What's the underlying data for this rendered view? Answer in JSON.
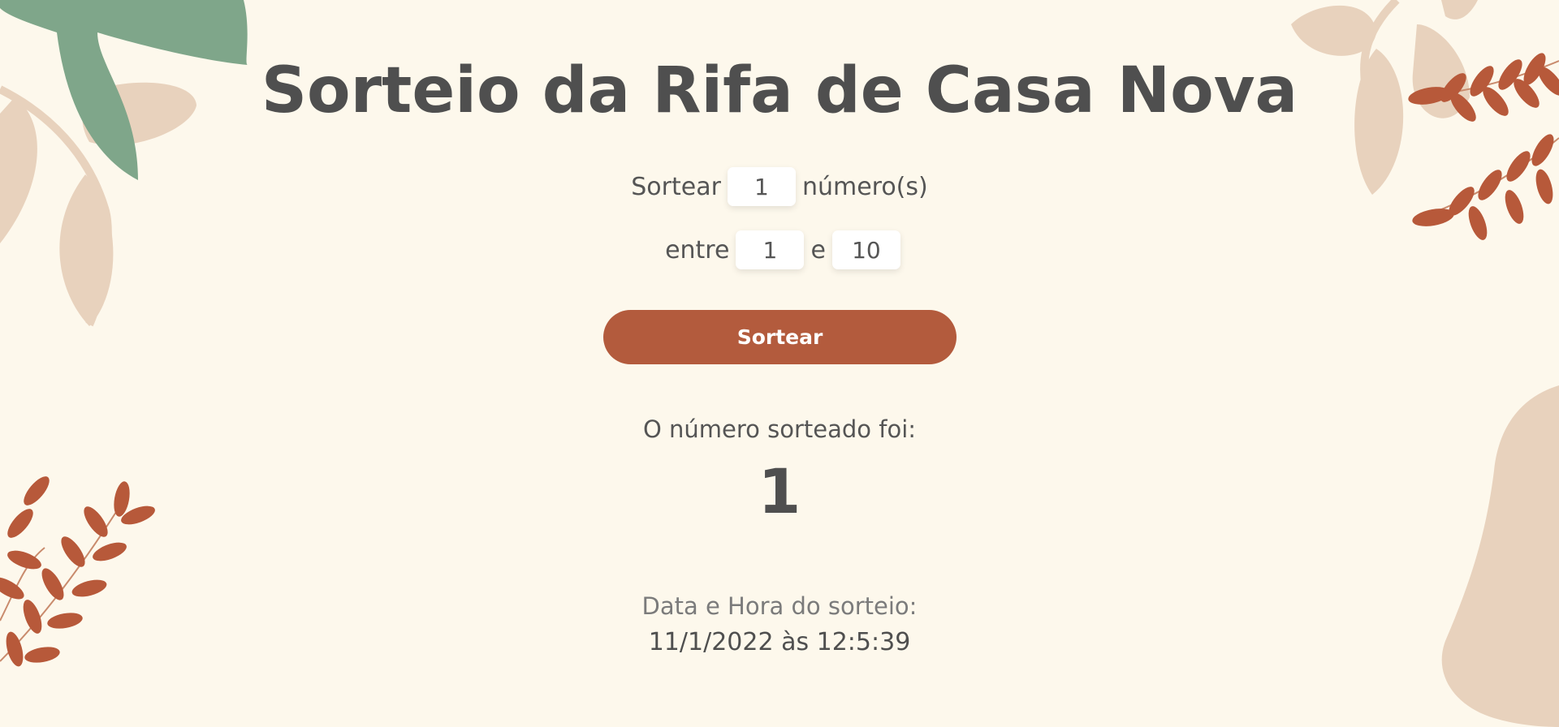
{
  "header": {
    "title": "Sorteio da Rifa de Casa Nova"
  },
  "form": {
    "quantity_prefix": "Sortear",
    "quantity_value": "1",
    "quantity_suffix": "número(s)",
    "range_prefix": "entre",
    "range_min_value": "1",
    "range_separator": "e",
    "range_max_value": "10"
  },
  "actions": {
    "draw_button_label": "Sortear"
  },
  "result": {
    "label": "O número sorteado foi:",
    "number": "1"
  },
  "draw_info": {
    "datetime_label": "Data e Hora do sorteio:",
    "datetime_value": "11/1/2022 às 12:5:39"
  },
  "colors": {
    "background": "#fdf8ec",
    "accent": "#b35b3d",
    "text": "#4f4f4f",
    "leaf_green": "#7fa68a",
    "leaf_beige": "#e8d2bd",
    "leaf_rust": "#b7593a"
  },
  "decorations": [
    "green-leaf-icon",
    "beige-leaf-icon",
    "rust-fern-icon",
    "beige-blob-icon"
  ]
}
